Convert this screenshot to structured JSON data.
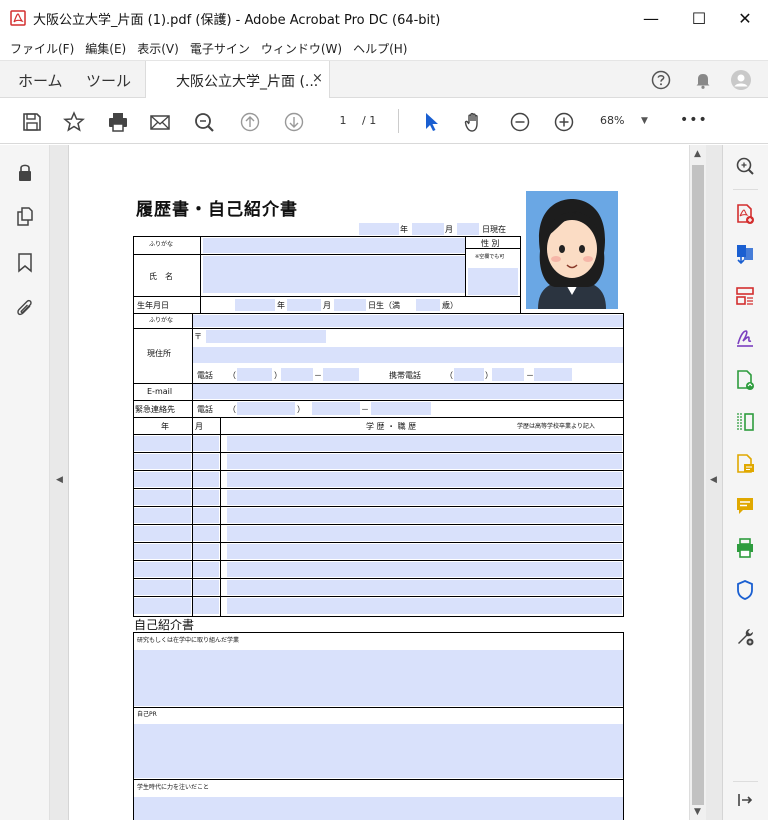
{
  "window": {
    "title": "大阪公立大学_片面 (1).pdf (保護) - Adobe Acrobat Pro DC (64-bit)",
    "minimize": "—",
    "maximize": "☐",
    "close": "✕"
  },
  "menu": [
    "ファイル(F)",
    "編集(E)",
    "表示(V)",
    "電子サイン",
    "ウィンドウ(W)",
    "ヘルプ(H)"
  ],
  "tabs": {
    "home": "ホーム",
    "tools": "ツール",
    "document": "大阪公立大学_片面 (...",
    "close": "×"
  },
  "toolbar": {
    "page_current": "1",
    "page_total": "/ 1",
    "zoom": "68%",
    "zoom_caret": "▼",
    "more": "•••"
  },
  "scroll": {
    "up": "▲",
    "down": "▼",
    "left_arrow": "◀",
    "right_arrow": "◀"
  },
  "form": {
    "title": "履歴書・自己紹介書",
    "date_year": "年",
    "date_month": "月",
    "date_suffix": "日現在",
    "furigana": "ふりがな",
    "gender": "性 別",
    "gender_note": "※空欄でも可",
    "name": "氏　名",
    "birth": "生年月日",
    "birth_year": "年",
    "birth_month": "月",
    "birth_day": "日生（満",
    "birth_age": "歳）",
    "furigana2": "ふりがな",
    "postal": "〒",
    "address": "現住所",
    "tel": "電話",
    "paren_open": "（",
    "paren_close": "）",
    "dash": "－",
    "mobile": "携帯電話",
    "email": "E-mail",
    "emergency": "緊急連絡先",
    "tel2": "電話",
    "hist_year": "年",
    "hist_month": "月",
    "hist_title": "学 歴 ・ 職 歴",
    "hist_note": "学歴は高等学校卒業より記入",
    "intro_title": "自己紹介書",
    "research": "研究もしくは在学中に取り組んだ学業",
    "pr": "自己PR",
    "student_life": "学生時代に力を注いだこと"
  },
  "colors": {
    "accent": "#d32f2f",
    "field_fill": "#d9e1fb",
    "tool_green": "#2e9c3e",
    "tool_purple": "#7b3fbf",
    "tool_blue": "#1a5fd1"
  }
}
